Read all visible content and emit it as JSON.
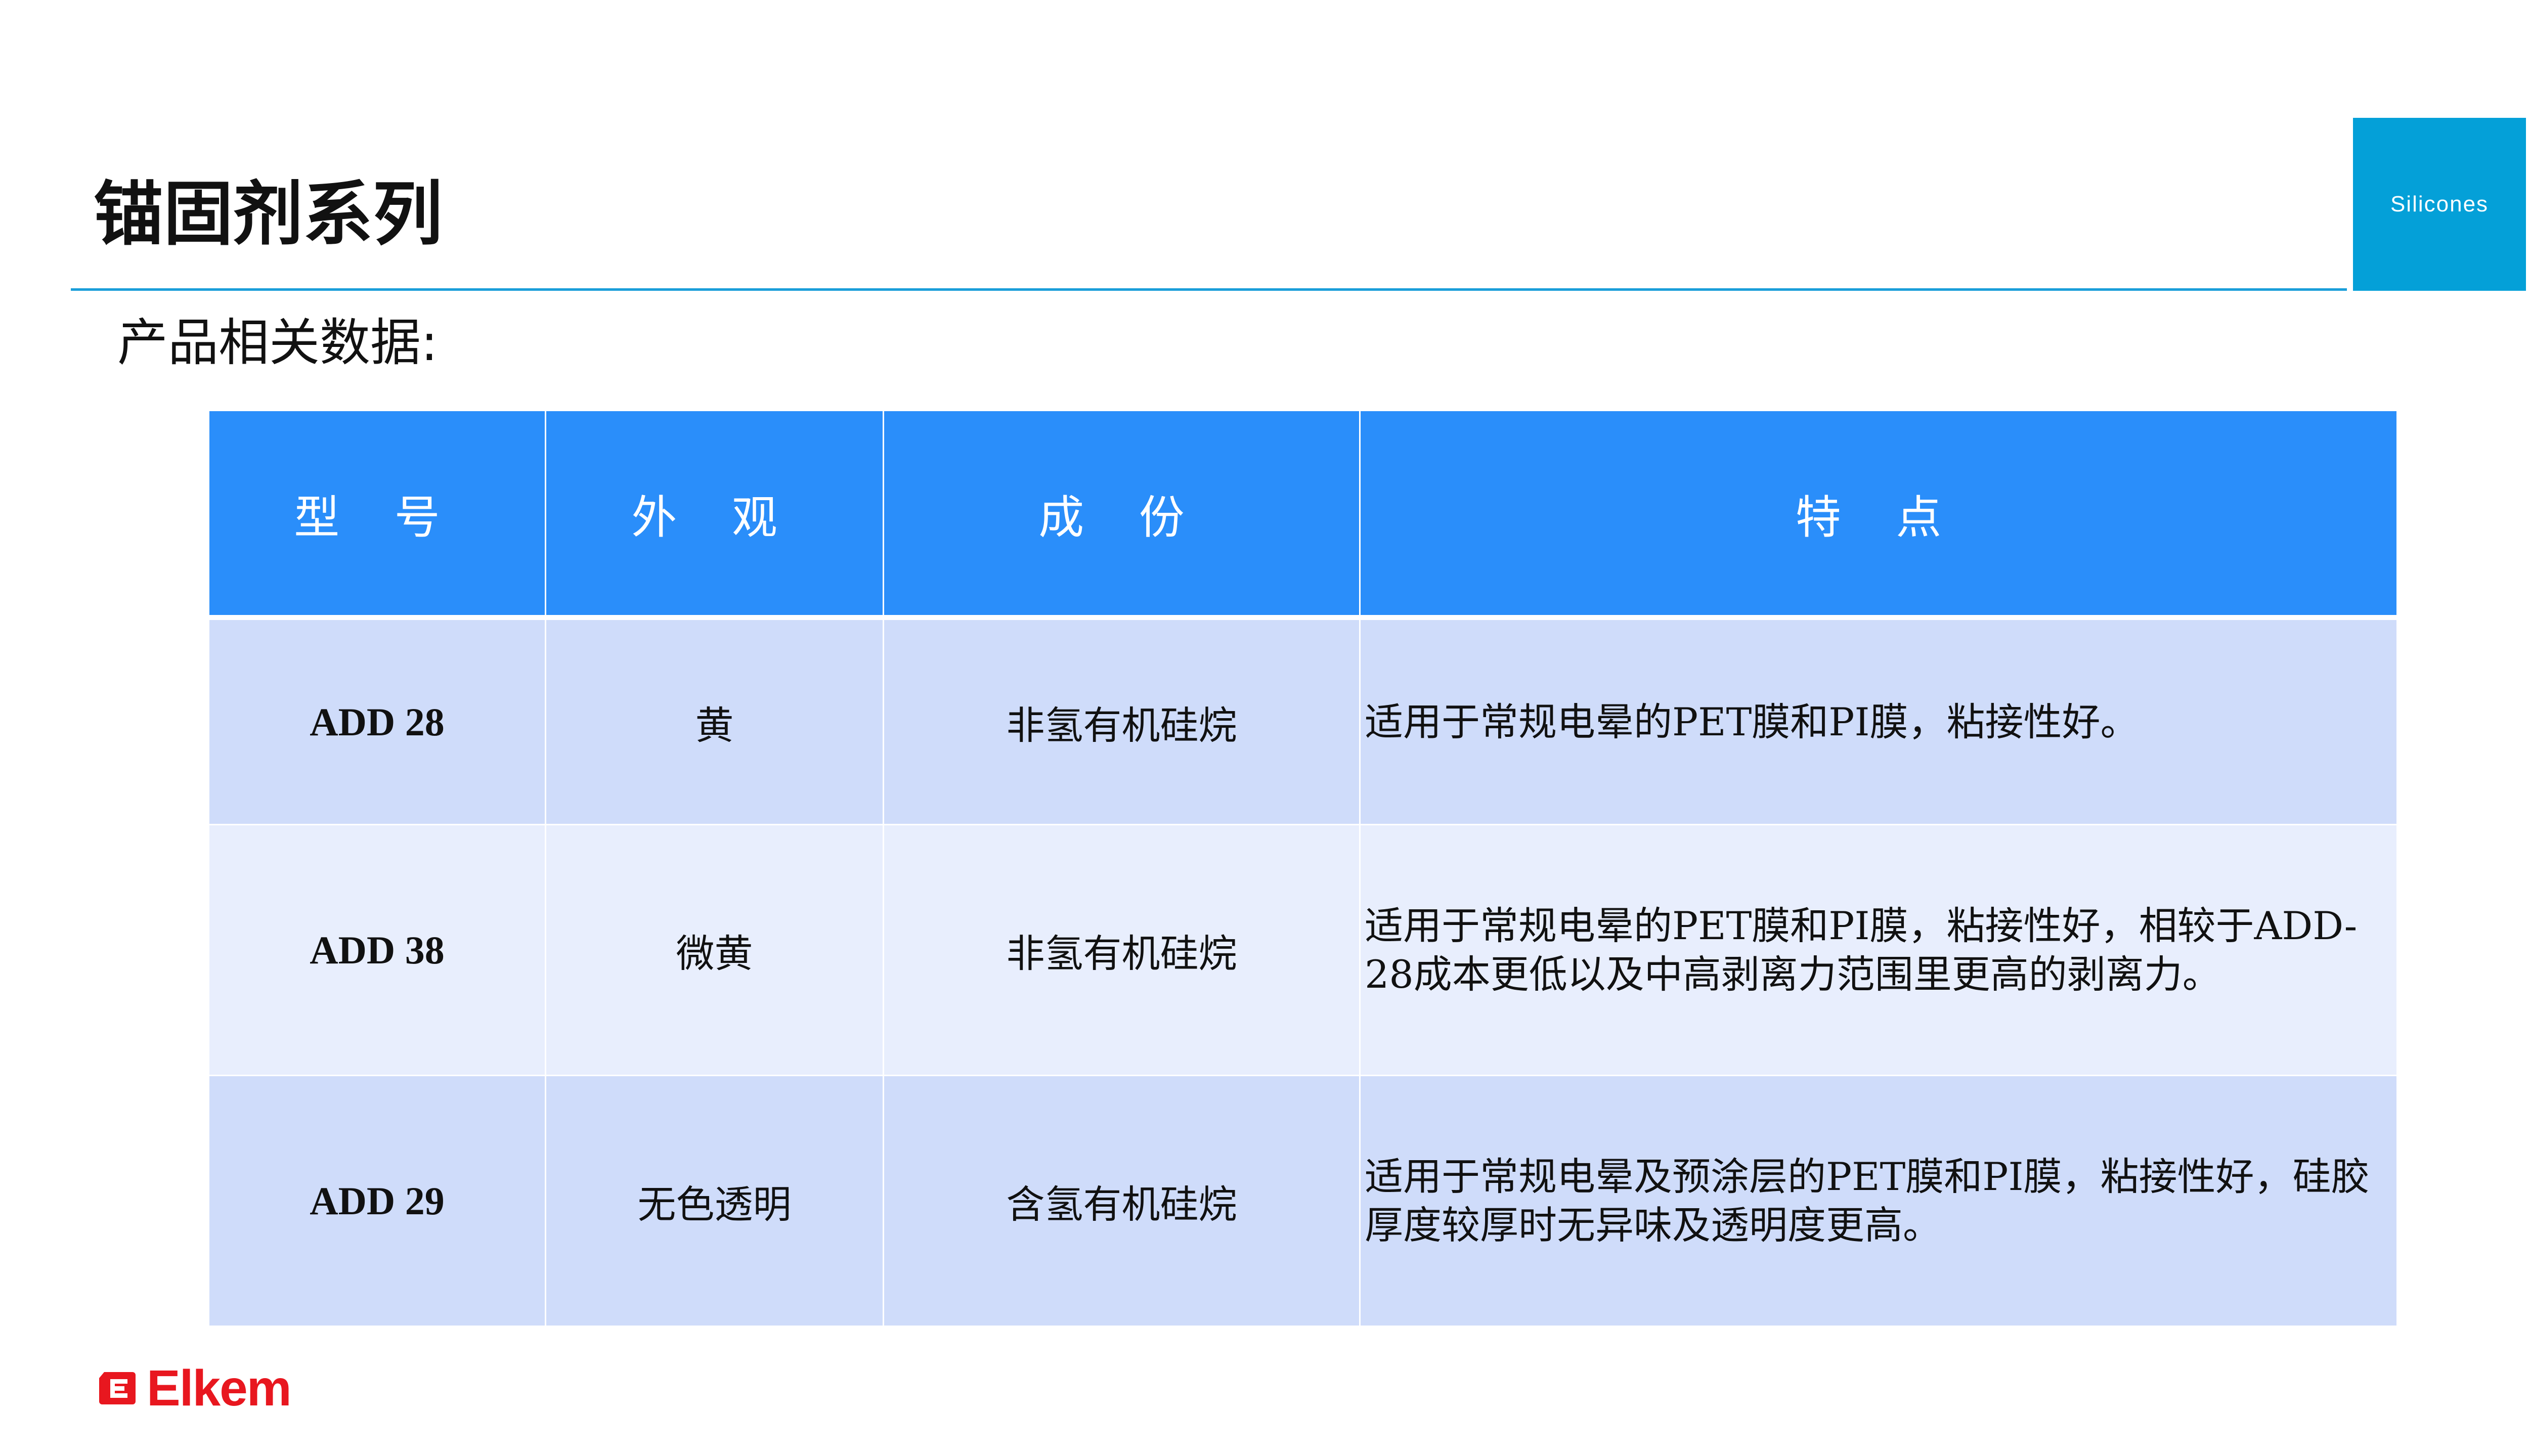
{
  "header": {
    "title": "锚固剂系列",
    "badge": "Silicones"
  },
  "subtitle": "产品相关数据:",
  "table": {
    "headers": [
      "型 号",
      "外 观",
      "成 份",
      "特 点"
    ],
    "rows": [
      {
        "model": "ADD 28",
        "appearance": "黄",
        "composition": "非氢有机硅烷",
        "features": "适用于常规电晕的PET膜和PI膜，粘接性好。"
      },
      {
        "model": "ADD 38",
        "appearance": "微黄",
        "composition": "非氢有机硅烷",
        "features": "适用于常规电晕的PET膜和PI膜，粘接性好，相较于ADD-28成本更低以及中高剥离力范围里更高的剥离力。"
      },
      {
        "model": "ADD 29",
        "appearance": "无色透明",
        "composition": "含氢有机硅烷",
        "features": "适用于常规电晕及预涂层的PET膜和PI膜，粘接性好，硅胶厚度较厚时无异味及透明度更高。"
      }
    ]
  },
  "footer": {
    "brand": "Elkem"
  },
  "colors": {
    "accent": "#04a0d8",
    "header_fill": "#2a8efa",
    "row_dark": "#cfdcfa",
    "row_light": "#e8eefd",
    "brand_red": "#e8171f"
  }
}
